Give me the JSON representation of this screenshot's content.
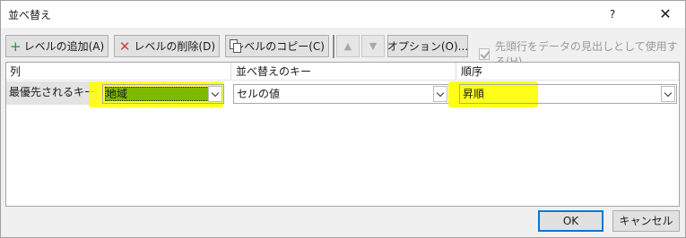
{
  "window": {
    "title": "並べ替え",
    "help_label": "?",
    "close_label": "✕"
  },
  "toolbar": {
    "add_level_label": "レベルの追加(A)",
    "delete_level_label": "レベルの削除(D)",
    "copy_level_label": "レベルのコピー(C)",
    "move_up_label": "▲",
    "move_down_label": "▼",
    "options_label": "オプション(O)...",
    "has_headers_label": "先頭行をデータの見出しとして使用する(H)",
    "has_headers_checked": true,
    "has_headers_enabled": false
  },
  "grid": {
    "headers": {
      "column": "列",
      "sort_on": "並べ替えのキー",
      "order": "順序"
    },
    "rows": [
      {
        "label": "最優先されるキー",
        "column_value": "地域",
        "sort_on_value": "セルの値",
        "order_value": "昇順"
      }
    ]
  },
  "buttons": {
    "ok_label": "OK",
    "cancel_label": "キャンセル"
  },
  "colors": {
    "highlight_yellow": "#ffff00",
    "selected_green": "#7fb800",
    "ok_border": "#0078d7"
  }
}
